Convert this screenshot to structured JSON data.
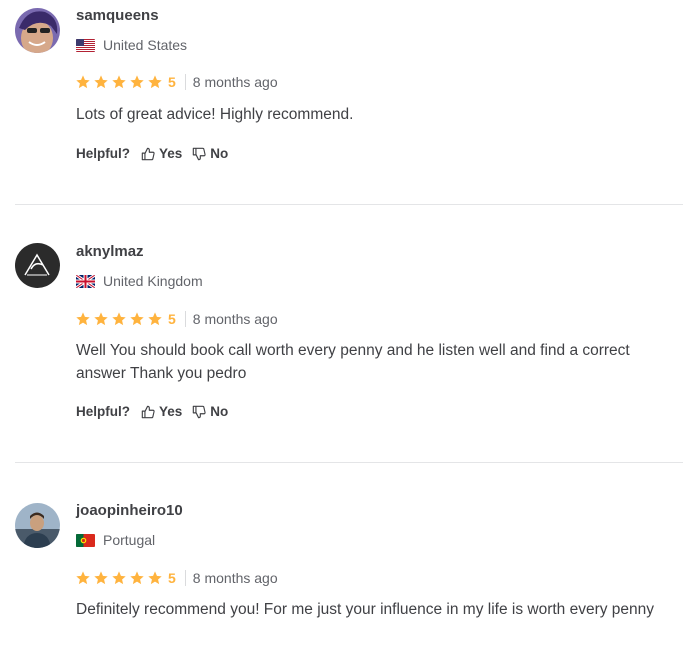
{
  "reviews": [
    {
      "username": "samqueens",
      "country": "United States",
      "flag_icon": "us-flag-icon",
      "rating": "5",
      "time": "8 months ago",
      "text": "Lots of great advice! Highly recommend.",
      "helpful_label": "Helpful?",
      "yes_label": "Yes",
      "no_label": "No"
    },
    {
      "username": "aknylmaz",
      "country": "United Kingdom",
      "flag_icon": "uk-flag-icon",
      "rating": "5",
      "time": "8 months ago",
      "text": "Well You should book call worth every penny and he listen well and find a correct answer Thank you pedro",
      "helpful_label": "Helpful?",
      "yes_label": "Yes",
      "no_label": "No"
    },
    {
      "username": "joaopinheiro10",
      "country": "Portugal",
      "flag_icon": "portugal-flag-icon",
      "rating": "5",
      "time": "8 months ago",
      "text": "Definitely recommend you! For me just your influence in my life is worth every penny"
    }
  ],
  "colors": {
    "star": "#ffb33e",
    "text": "#404145",
    "muted": "#62646a",
    "divider": "#e4e5e7"
  },
  "icons": {
    "star": "star-icon",
    "yes": "thumbs-up-icon",
    "no": "thumbs-down-icon"
  }
}
